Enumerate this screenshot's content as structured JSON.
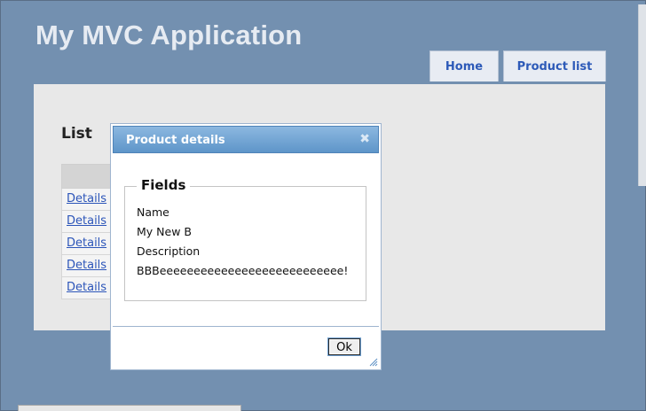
{
  "header": {
    "title": "My MVC Application"
  },
  "nav": {
    "home": "Home",
    "product_list": "Product list"
  },
  "main": {
    "heading": "List",
    "rows": [
      "Details",
      "Details",
      "Details",
      "Details",
      "Details"
    ]
  },
  "dialog": {
    "title": "Product details",
    "close_icon": "close-icon",
    "fieldset_legend": "Fields",
    "name_label": "Name",
    "name_value": "My New B",
    "description_label": "Description",
    "description_value": "BBBeeeeeeeeeeeeeeeeeeeeeeeeeee!",
    "ok_label": "Ok"
  },
  "colors": {
    "page_background": "#7390b0",
    "title_text": "#e6ebf2",
    "nav_link": "#2d5ab8",
    "panel_background": "#e8e8e8",
    "dialog_titlebar": "#5e95c9"
  }
}
